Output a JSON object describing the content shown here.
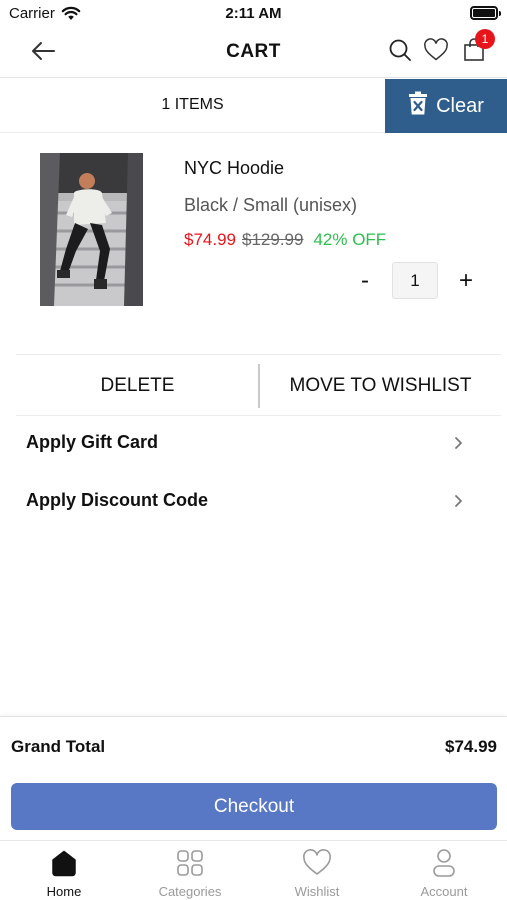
{
  "status_bar": {
    "carrier": "Carrier",
    "time": "2:11 AM"
  },
  "header": {
    "title": "CART",
    "back_icon": "arrow-left-icon",
    "search_icon": "search-icon",
    "wishlist_icon": "heart-icon",
    "cart_icon": "shopping-bag-icon",
    "cart_badge_count": "1"
  },
  "items_bar": {
    "count_label": "1 ITEMS",
    "clear_label": "Clear",
    "clear_icon": "trash-x-icon"
  },
  "cart_item": {
    "name": "NYC Hoodie",
    "variant": "Black / Small (unisex)",
    "sale_price": "$74.99",
    "original_price": "$129.99",
    "discount": "42% OFF",
    "quantity": "1",
    "minus_label": "-",
    "plus_label": "+"
  },
  "actions": {
    "delete_label": "DELETE",
    "wishlist_label": "MOVE TO WISHLIST"
  },
  "apply": {
    "gift_card_label": "Apply Gift Card",
    "discount_code_label": "Apply Discount Code"
  },
  "summary": {
    "grand_total_label": "Grand Total",
    "grand_total_value": "$74.99",
    "checkout_label": "Checkout"
  },
  "tabs": [
    {
      "label": "Home",
      "icon": "home-icon",
      "active": true
    },
    {
      "label": "Categories",
      "icon": "grid-icon",
      "active": false
    },
    {
      "label": "Wishlist",
      "icon": "heart-icon",
      "active": false
    },
    {
      "label": "Account",
      "icon": "user-icon",
      "active": false
    }
  ],
  "colors": {
    "clear_button": "#2f5d8c",
    "checkout_button": "#5878c6",
    "sale_price": "#e8141b",
    "discount": "#2ebd4f",
    "badge": "#e8141b"
  }
}
